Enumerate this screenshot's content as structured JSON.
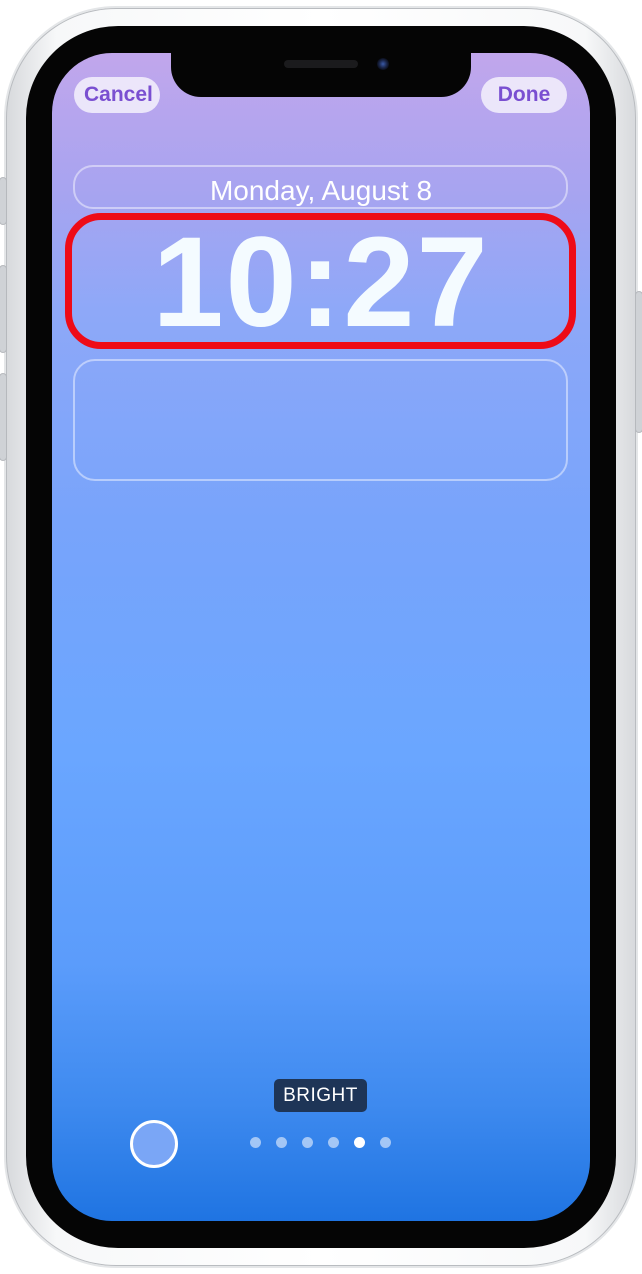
{
  "toolbar": {
    "cancel_label": "Cancel",
    "done_label": "Done"
  },
  "lock_screen": {
    "date": "Monday, August 8",
    "time": "10:27"
  },
  "filter": {
    "label": "BRIGHT",
    "page_count": 6,
    "active_index": 4
  },
  "colors": {
    "highlight": "#ee0b17",
    "accent": "#7a4fd1",
    "filter_label_bg": "#1e3557",
    "color_swatch": "#7aa6f6"
  }
}
